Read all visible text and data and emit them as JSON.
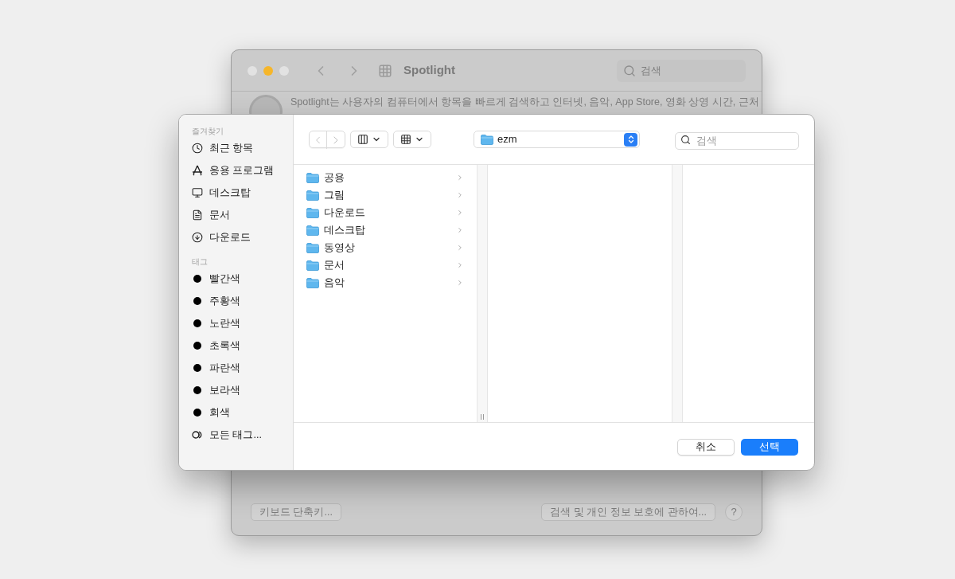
{
  "background_window": {
    "title": "Spotlight",
    "search_placeholder": "검색",
    "description": "Spotlight는 사용자의 컴퓨터에서 항목을 빠르게 검색하고 인터넷, 음악, App Store, 영화 상영 시간, 근처",
    "footer_buttons": [
      {
        "label": "키보드 단축키..."
      },
      {
        "label": "검색 및 개인 정보 보호에 관하여..."
      }
    ],
    "help": "?"
  },
  "dialog": {
    "sidebar": [
      {
        "heading": "즐겨찾기",
        "items": [
          {
            "label": "최근 항목",
            "kind": "clock"
          },
          {
            "label": "응용 프로그램",
            "kind": "apps"
          },
          {
            "label": "데스크탑",
            "kind": "desktop"
          },
          {
            "label": "문서",
            "kind": "document"
          },
          {
            "label": "다운로드",
            "kind": "download"
          }
        ]
      },
      {
        "heading": "태그",
        "items": [
          {
            "label": "빨간색",
            "kind": "tag"
          },
          {
            "label": "주황색",
            "kind": "tag"
          },
          {
            "label": "노란색",
            "kind": "tag"
          },
          {
            "label": "초록색",
            "kind": "tag"
          },
          {
            "label": "파란색",
            "kind": "tag"
          },
          {
            "label": "보라색",
            "kind": "tag"
          },
          {
            "label": "회색",
            "kind": "tag"
          },
          {
            "label": "모든 태그...",
            "kind": "all_tags"
          }
        ]
      }
    ],
    "location": "ezm",
    "search_placeholder": "검색",
    "column_items": [
      {
        "name": "공용"
      },
      {
        "name": "그림"
      },
      {
        "name": "다운로드"
      },
      {
        "name": "데스크탑"
      },
      {
        "name": "동영상"
      },
      {
        "name": "문서"
      },
      {
        "name": "음악"
      }
    ],
    "buttons": [
      {
        "label": "취소",
        "kind": "default"
      },
      {
        "label": "선택",
        "kind": "primary"
      }
    ]
  }
}
